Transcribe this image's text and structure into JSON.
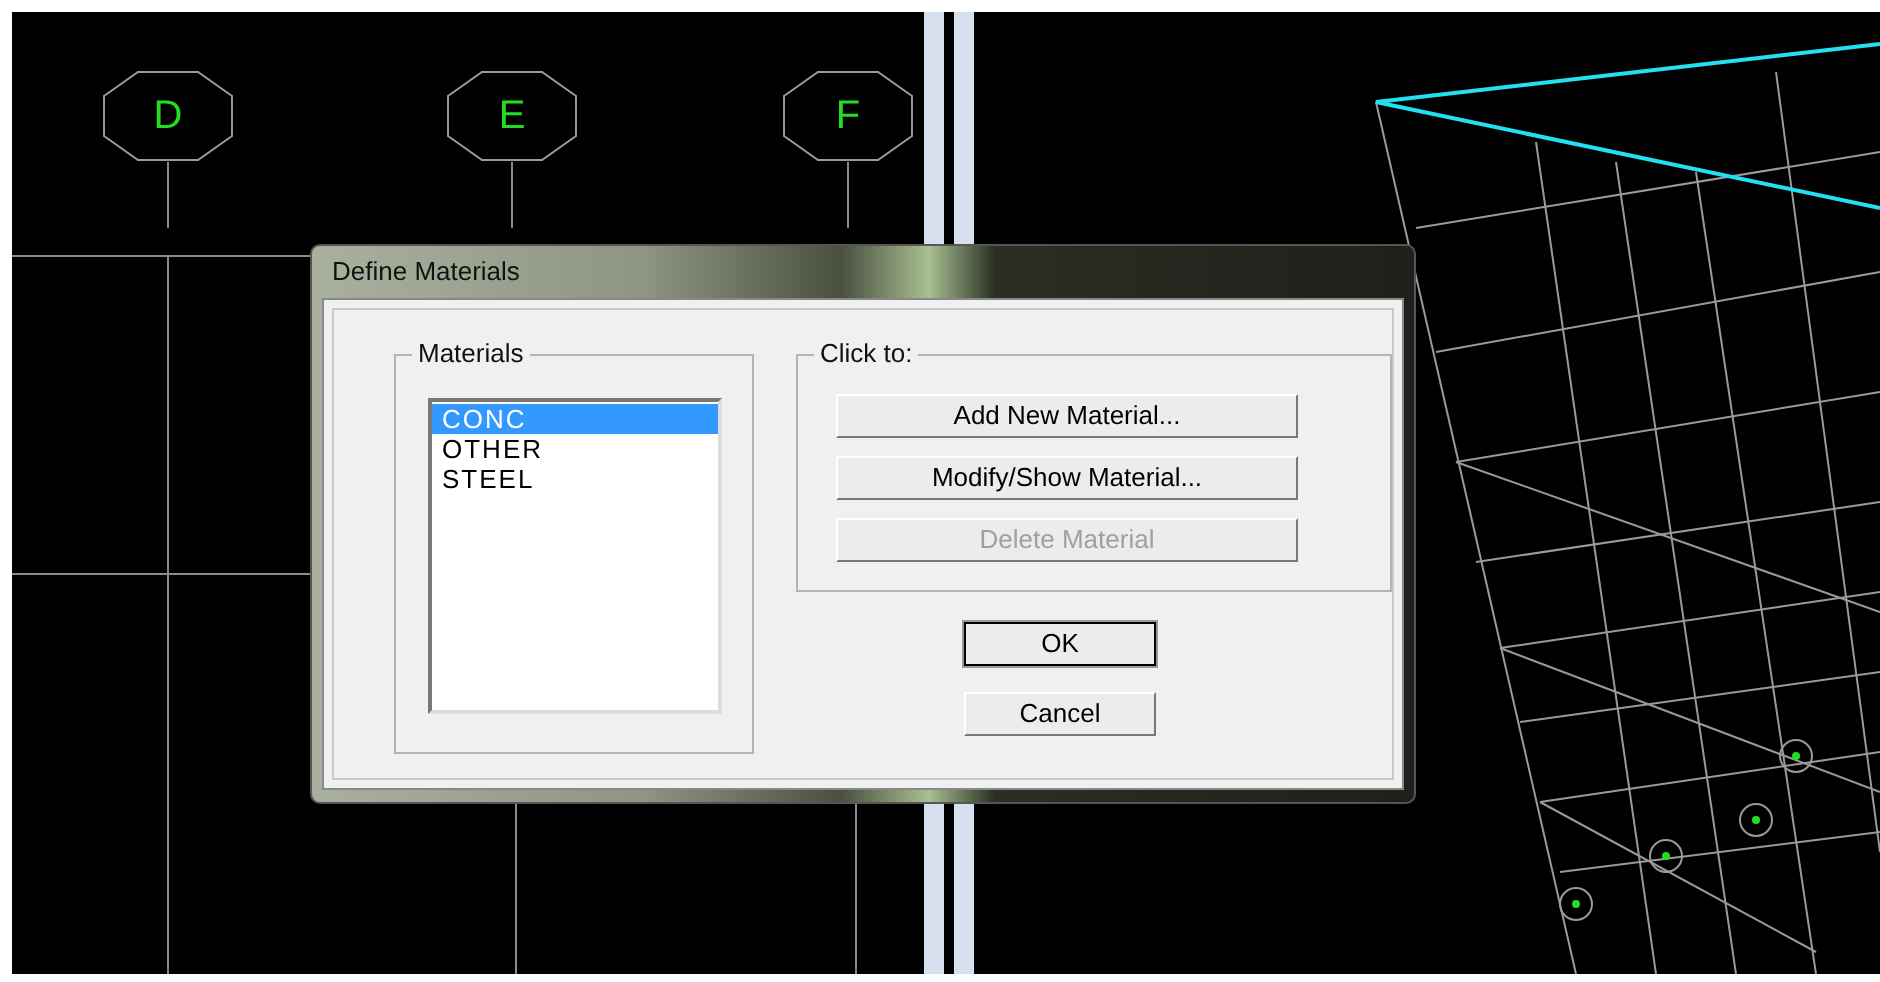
{
  "grid_bubbles": [
    {
      "label": "D"
    },
    {
      "label": "E"
    },
    {
      "label": "F"
    }
  ],
  "dialog": {
    "title": "Define Materials",
    "materials_group": {
      "title": "Materials",
      "items": [
        {
          "label": "CONC",
          "selected": true
        },
        {
          "label": "OTHER",
          "selected": false
        },
        {
          "label": "STEEL",
          "selected": false
        }
      ]
    },
    "actions_group": {
      "title": "Click to:",
      "buttons": [
        {
          "label": "Add New Material...",
          "disabled": false
        },
        {
          "label": "Modify/Show Material...",
          "disabled": false
        },
        {
          "label": "Delete Material",
          "disabled": true
        }
      ]
    },
    "buttons": [
      {
        "label": "OK",
        "default": true
      },
      {
        "label": "Cancel",
        "default": false
      }
    ]
  }
}
